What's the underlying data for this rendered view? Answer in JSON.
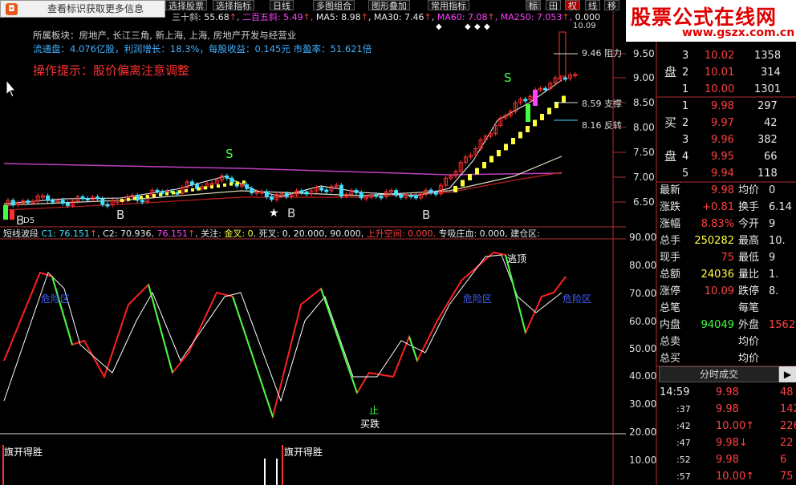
{
  "toolbar": {
    "notify_text": "查看标识获取更多信息",
    "notify_icon": "logo-icon",
    "buttons": [
      "选择股票",
      "选择指标",
      "日线",
      "多图组合",
      "图形叠加",
      "常用指标"
    ],
    "right_tabs": [
      "标",
      "田",
      "权",
      "线",
      "移"
    ]
  },
  "logo": {
    "title": "股票公式在线网",
    "url": "www.gszx.com.cn"
  },
  "ma_line": {
    "items": [
      {
        "label": "三十斜:",
        "value": "55.68",
        "color": "#e8e8e8"
      },
      {
        "label": "二百五斜:",
        "value": "5.49",
        "color": "#ff40ff"
      },
      {
        "label": "MA5:",
        "value": "8.98",
        "color": "#e8e8e8"
      },
      {
        "label": "MA30:",
        "value": "7.46",
        "color": "#ffff40"
      },
      {
        "label": "MA60:",
        "value": "7.08",
        "color": "#ff40ff"
      },
      {
        "label": "MA250:",
        "value": "7.053",
        "color": "#ff40ff"
      },
      {
        "label": "",
        "value": "0.000",
        "color": "#e8e8e8"
      }
    ]
  },
  "info": {
    "sector": "所属板块：房地产, 长江三角, 新上海, 上海, 房地产开发与经营业",
    "float": "流通盘：4.076亿股，利润增长：18.3%，每股收益：0.145元 市盈率：51.621倍",
    "hint": "操作提示：股价偏离注意调整"
  },
  "price_axis": [
    "9.50",
    "9.00",
    "8.50",
    "8.00",
    "7.50",
    "7.00",
    "6.50"
  ],
  "price_levels": [
    {
      "value": "9.46",
      "label": "阻力"
    },
    {
      "value": "8.59",
      "label": "支撑"
    },
    {
      "value": "8.16",
      "label": "反转"
    }
  ],
  "top_price": "10.09",
  "marks": {
    "b_labels": [
      "B",
      "B",
      "B",
      "B"
    ],
    "star": "★",
    "s_labels": [
      "S",
      "S"
    ],
    "d05": "D5"
  },
  "indicator": {
    "title": "短线波段",
    "c1": "C1: 76.151",
    "c2": "C2: 70.936",
    "c3": "76.151",
    "focus_label": "关注:",
    "gold": "金叉: 0",
    "dead": "死叉: 0, 20.000, 90.000,",
    "up": "上升空间: 0.000,",
    "special": "专吸庄血: 0.000,",
    "build": "建仓区:",
    "axis": [
      "90.00",
      "80.00",
      "70.00",
      "60.00",
      "50.00",
      "40.00",
      "30.00",
      "20.00",
      "10.00"
    ],
    "danger": [
      "危险区",
      "危险区",
      "危险区"
    ],
    "escape": "逃顶",
    "stop": "止",
    "buy": "买跌",
    "flag": "旗开得胜"
  },
  "orderbook": {
    "sell": [
      {
        "side": "",
        "n": "3",
        "price": "10.02",
        "vol": "1358"
      },
      {
        "side": "盘",
        "n": "2",
        "price": "10.01",
        "vol": "314"
      },
      {
        "side": "",
        "n": "1",
        "price": "10.00",
        "vol": "1301"
      }
    ],
    "buy": [
      {
        "side": "",
        "n": "1",
        "price": "9.98",
        "vol": "297"
      },
      {
        "side": "买",
        "n": "2",
        "price": "9.97",
        "vol": "42"
      },
      {
        "side": "",
        "n": "3",
        "price": "9.96",
        "vol": "382"
      },
      {
        "side": "盘",
        "n": "4",
        "price": "9.95",
        "vol": "66"
      },
      {
        "side": "",
        "n": "5",
        "price": "9.94",
        "vol": "118"
      }
    ]
  },
  "stats": [
    {
      "l": "最新",
      "v": "9.98",
      "l2": "均价",
      "v2": "0"
    },
    {
      "l": "涨跌",
      "v": "+0.81",
      "l2": "换手",
      "v2": "6.14"
    },
    {
      "l": "涨幅",
      "v": "8.83%",
      "l2": "今开",
      "v2": "9"
    },
    {
      "l": "总手",
      "v": "250282",
      "l2": "最高",
      "v2": "10."
    },
    {
      "l": "现手",
      "v": "75",
      "l2": "最低",
      "v2": "9"
    },
    {
      "l": "总额",
      "v": "24036",
      "l2": "量比",
      "v2": "1."
    },
    {
      "l": "涨停",
      "v": "10.09",
      "l2": "跌停",
      "v2": "8."
    },
    {
      "l": "总笔",
      "v": "",
      "l2": "每笔",
      "v2": ""
    },
    {
      "l": "内盘",
      "v": "94049",
      "l2": "外盘",
      "v2": "1562"
    },
    {
      "l": "总卖",
      "v": "",
      "l2": "均价",
      "v2": ""
    },
    {
      "l": "总买",
      "v": "",
      "l2": "均价",
      "v2": ""
    }
  ],
  "ticks_header": "分时成交",
  "ticks": [
    {
      "t": "14:59",
      "p": "9.98",
      "v": "48",
      "a": ""
    },
    {
      "t": ":37",
      "p": "9.98",
      "v": "142",
      "a": ""
    },
    {
      "t": ":42",
      "p": "10.00",
      "v": "226",
      "a": "↑"
    },
    {
      "t": ":47",
      "p": "9.98",
      "v": "22",
      "a": "↓"
    },
    {
      "t": ":52",
      "p": "9.98",
      "v": "6",
      "a": ""
    },
    {
      "t": ":57",
      "p": "10.00",
      "v": "75",
      "a": "↑"
    }
  ],
  "colors": {
    "up": "#ff3030",
    "down": "#40ff40",
    "cyan": "#40e0ff",
    "yellow": "#ffff40",
    "magenta": "#ff40ff"
  }
}
